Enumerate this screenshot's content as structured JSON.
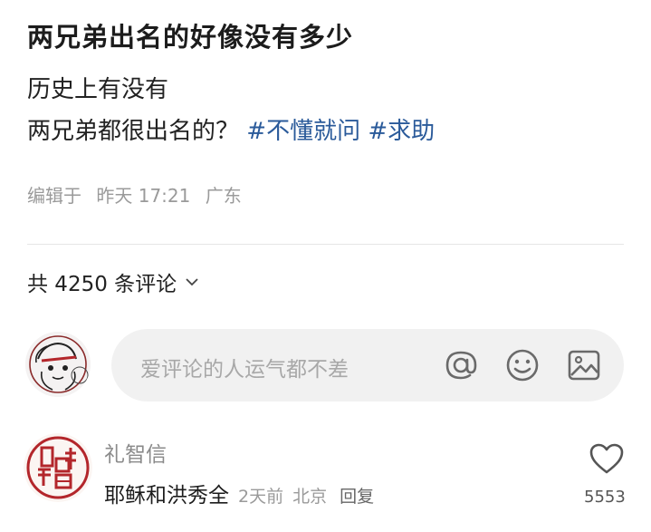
{
  "post": {
    "title": "两兄弟出名的好像没有多少",
    "body_line1": "历史上有没有",
    "body_line2": "两兄弟都很出名的？",
    "hashtags": [
      "#不懂就问",
      "#求助"
    ],
    "meta": {
      "action": "编辑于",
      "time": "昨天 17:21",
      "location": "广东"
    }
  },
  "comments_header": {
    "count_label": "共 4250 条评论"
  },
  "comment_input": {
    "placeholder": "爱评论的人运气都不差"
  },
  "comments": [
    {
      "author": "礼智信",
      "text": "耶稣和洪秀全",
      "time": "2天前",
      "location": "北京",
      "reply_label": "回复",
      "likes": "5553"
    }
  ],
  "colors": {
    "hashtag": "#2a5a9a",
    "seal_red": "#b3262b",
    "muted_text": "#9a9a9a"
  },
  "icons": [
    "chevron-down-icon",
    "at-icon",
    "emoji-icon",
    "image-icon",
    "heart-icon"
  ]
}
